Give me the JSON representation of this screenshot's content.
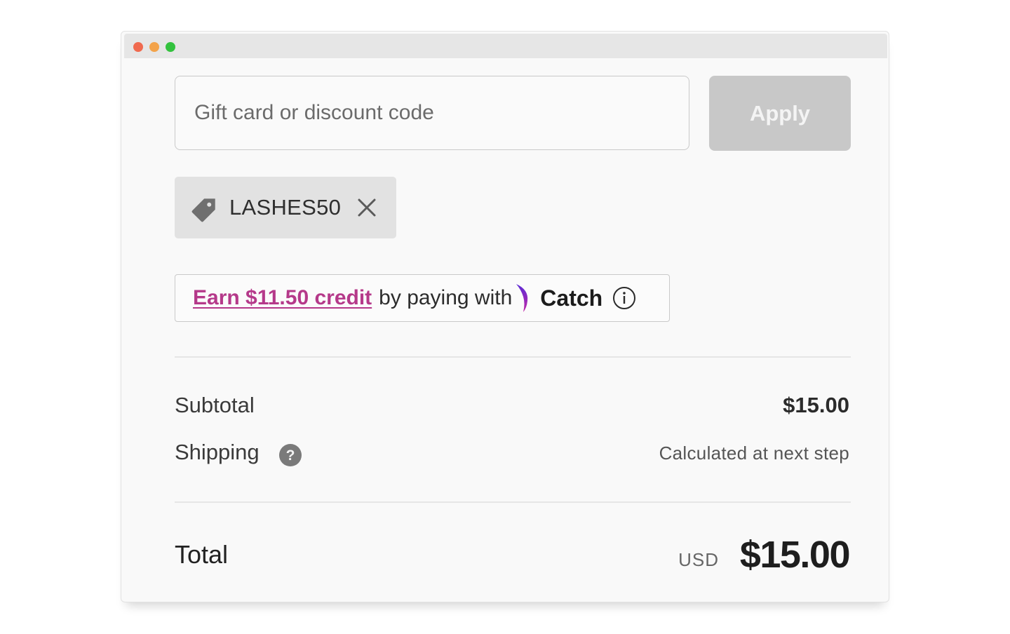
{
  "window": {
    "controls": [
      "close",
      "minimize",
      "zoom"
    ],
    "colors": {
      "close": "#f06a4f",
      "minimize": "#f3a34a",
      "zoom": "#33c23e"
    }
  },
  "discount": {
    "placeholder": "Gift card or discount code",
    "value": "",
    "apply_label": "Apply",
    "applied_code": "LASHES50",
    "applied_code_icon": "tag-icon",
    "remove_icon": "close-icon"
  },
  "catch_offer": {
    "link_text": "Earn $11.50 credit",
    "text": "by paying with",
    "brand": "Catch",
    "brand_color": "#b5398a",
    "info_icon": "info-icon"
  },
  "summary": {
    "subtotal_label": "Subtotal",
    "subtotal_value": "$15.00",
    "shipping_label": "Shipping",
    "shipping_help_icon": "question-icon",
    "shipping_value": "Calculated at next step",
    "total_label": "Total",
    "currency": "USD",
    "total_value": "$15.00"
  }
}
